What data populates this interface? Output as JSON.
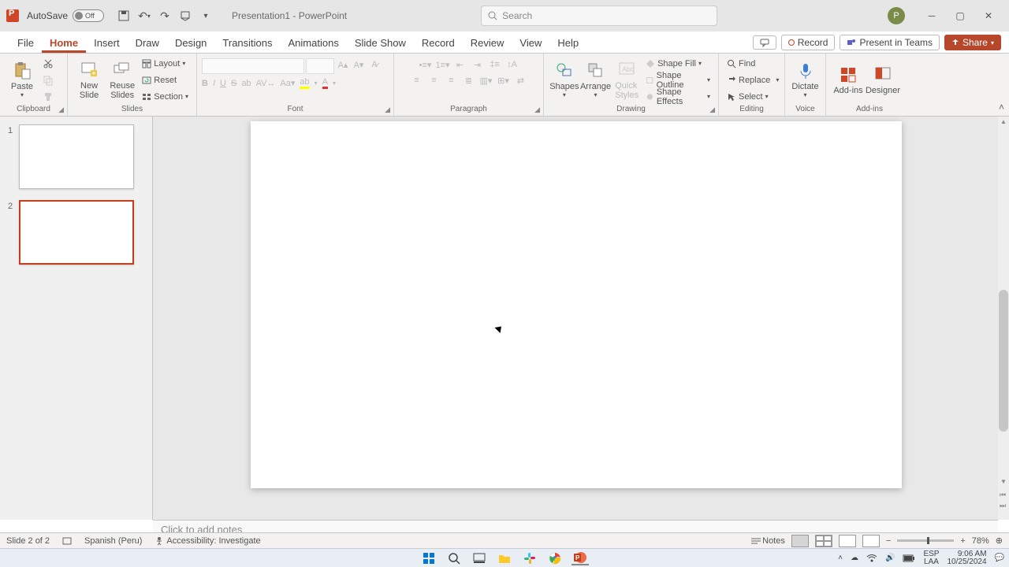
{
  "titlebar": {
    "autosave_label": "AutoSave",
    "autosave_state": "Off",
    "doc_title": "Presentation1 - PowerPoint",
    "search_placeholder": "Search",
    "profile_initial": "P"
  },
  "tabs": {
    "items": [
      "File",
      "Home",
      "Insert",
      "Draw",
      "Design",
      "Transitions",
      "Animations",
      "Slide Show",
      "Record",
      "Review",
      "View",
      "Help"
    ],
    "active": "Home",
    "record": "Record",
    "present": "Present in Teams",
    "share": "Share"
  },
  "ribbon": {
    "clipboard": {
      "paste": "Paste",
      "label": "Clipboard"
    },
    "slides": {
      "new_slide": "New\nSlide",
      "reuse": "Reuse\nSlides",
      "layout": "Layout",
      "reset": "Reset",
      "section": "Section",
      "label": "Slides"
    },
    "font": {
      "label": "Font"
    },
    "paragraph": {
      "label": "Paragraph"
    },
    "drawing": {
      "shapes": "Shapes",
      "arrange": "Arrange",
      "quick": "Quick\nStyles",
      "fill": "Shape Fill",
      "outline": "Shape Outline",
      "effects": "Shape Effects",
      "label": "Drawing"
    },
    "editing": {
      "find": "Find",
      "replace": "Replace",
      "select": "Select",
      "label": "Editing"
    },
    "voice": {
      "dictate": "Dictate",
      "label": "Voice"
    },
    "addins": {
      "addins": "Add-ins",
      "designer": "Designer",
      "label": "Add-ins"
    }
  },
  "thumbnails": {
    "slides": [
      {
        "num": "1"
      },
      {
        "num": "2"
      }
    ],
    "selected_index": 1
  },
  "notes": {
    "placeholder": "Click to add notes"
  },
  "statusbar": {
    "slide_counter": "Slide 2 of 2",
    "language": "Spanish (Peru)",
    "accessibility": "Accessibility: Investigate",
    "notes_btn": "Notes",
    "zoom_pct": "78%"
  },
  "taskbar": {
    "lang": "ESP",
    "region": "LAA",
    "time": "9:06 AM",
    "date": "10/25/2024"
  }
}
